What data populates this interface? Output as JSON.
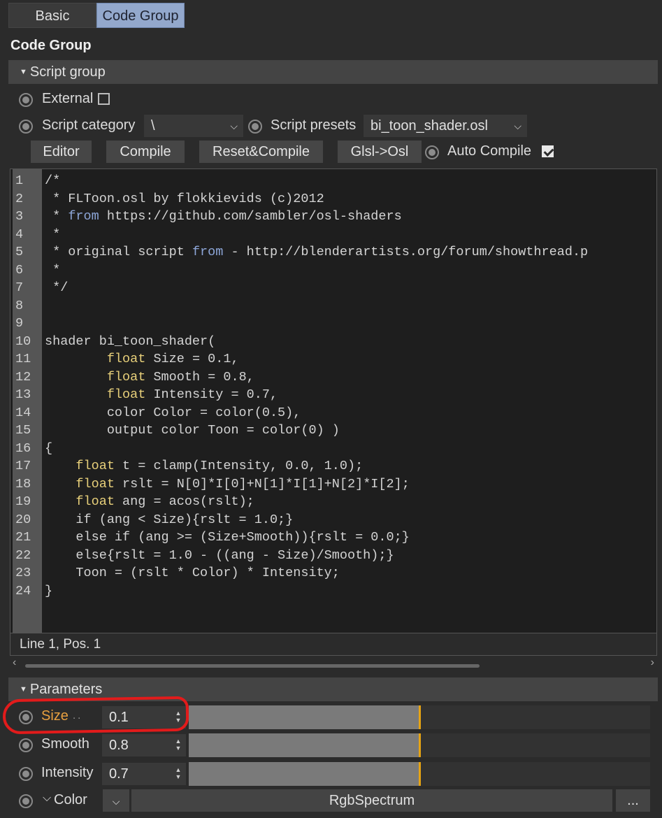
{
  "tabs": [
    {
      "label": "Basic",
      "active": false
    },
    {
      "label": "Code Group",
      "active": true
    }
  ],
  "section_title": "Code Group",
  "script_group": {
    "header": "Script group",
    "external_label": "External",
    "external_checked": false,
    "script_category_label": "Script category",
    "script_category_value": "\\",
    "script_presets_label": "Script presets",
    "script_presets_value": "bi_toon_shader.osl",
    "buttons": {
      "editor": "Editor",
      "compile": "Compile",
      "reset_compile": "Reset&Compile",
      "glsl_osl": "Glsl->Osl"
    },
    "auto_compile_label": "Auto Compile",
    "auto_compile_checked": true
  },
  "editor": {
    "lines": [
      {
        "n": "1",
        "text": "/*"
      },
      {
        "n": "2",
        "text": " * FLToon.osl by flokkievids (c)2012"
      },
      {
        "n": "3",
        "text": " * from https://github.com/sambler/osl-shaders"
      },
      {
        "n": "4",
        "text": " *"
      },
      {
        "n": "5",
        "text": " * original script from - http://blenderartists.org/forum/showthread.p"
      },
      {
        "n": "6",
        "text": " *"
      },
      {
        "n": "7",
        "text": " */"
      },
      {
        "n": "8",
        "text": ""
      },
      {
        "n": "9",
        "text": ""
      },
      {
        "n": "10",
        "text": "shader bi_toon_shader("
      },
      {
        "n": "11",
        "text": "        float Size = 0.1,"
      },
      {
        "n": "12",
        "text": "        float Smooth = 0.8,"
      },
      {
        "n": "13",
        "text": "        float Intensity = 0.7,"
      },
      {
        "n": "14",
        "text": "        color Color = color(0.5),"
      },
      {
        "n": "15",
        "text": "        output color Toon = color(0) )"
      },
      {
        "n": "16",
        "text": "{"
      },
      {
        "n": "17",
        "text": "    float t = clamp(Intensity, 0.0, 1.0);"
      },
      {
        "n": "18",
        "text": "    float rslt = N[0]*I[0]+N[1]*I[1]+N[2]*I[2];"
      },
      {
        "n": "19",
        "text": "    float ang = acos(rslt);"
      },
      {
        "n": "20",
        "text": "    if (ang < Size){rslt = 1.0;}"
      },
      {
        "n": "21",
        "text": "    else if (ang >= (Size+Smooth)){rslt = 0.0;}"
      },
      {
        "n": "22",
        "text": "    else{rslt = 1.0 - ((ang - Size)/Smooth);}"
      },
      {
        "n": "23",
        "text": "    Toon = (rslt * Color) * Intensity;"
      },
      {
        "n": "24",
        "text": "}"
      }
    ],
    "status": "Line 1, Pos. 1"
  },
  "parameters": {
    "header": "Parameters",
    "items": [
      {
        "label": "Size",
        "suffix": "..",
        "value": "0.1",
        "slider_level": 0.5,
        "highlighted": true,
        "color": "#e8a040"
      },
      {
        "label": "Smooth",
        "value": "0.8",
        "slider_level": 0.5
      },
      {
        "label": "Intensity",
        "value": "0.7",
        "slider_level": 0.5
      }
    ],
    "color_param": {
      "label": "Color",
      "type_value": "RgbSpectrum",
      "more_label": "..."
    }
  },
  "colors": {
    "active_tab": "#93a8cc",
    "slider_thumb": "#e6a313",
    "annotation": "#e21b1b",
    "keyword": "#e8d07a"
  }
}
